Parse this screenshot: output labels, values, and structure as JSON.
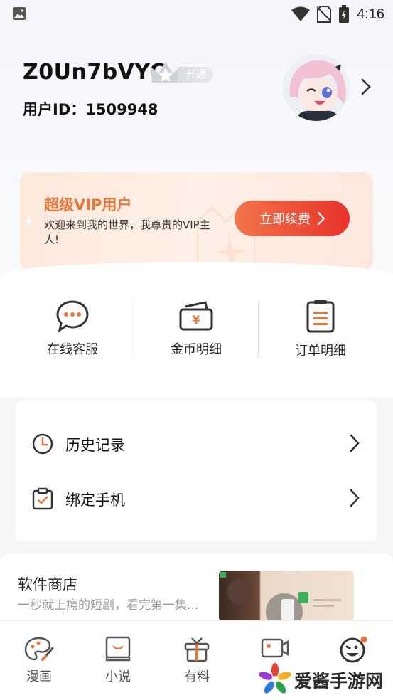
{
  "status_bar": {
    "time": "4:16",
    "icons": [
      "image-notification-icon",
      "wifi-icon",
      "no-sim-icon",
      "battery-charging-icon"
    ]
  },
  "profile": {
    "username": "Z0Un7bVYC",
    "vip_tag": "开通",
    "user_id": "用户ID：1509948"
  },
  "vip_banner": {
    "title": "超级VIP用户",
    "description": "欢迎来到我的世界，我尊贵的VIP主人!",
    "renew_button": "立即续费",
    "colors": {
      "title": "#e9763a",
      "button_start": "#f0754a",
      "button_end": "#e8322b"
    }
  },
  "quick_actions": [
    {
      "label": "在线客服",
      "icon": "chat-bubble-icon"
    },
    {
      "label": "金币明细",
      "icon": "wallet-icon"
    },
    {
      "label": "订单明细",
      "icon": "order-list-icon"
    }
  ],
  "menu": [
    {
      "label": "历史记录",
      "icon": "clock-icon"
    },
    {
      "label": "绑定手机",
      "icon": "clipboard-check-icon"
    }
  ],
  "store": {
    "title": "软件商店",
    "subtitle": "一秒就上瘾的短剧，看完第一集..."
  },
  "tabs": [
    {
      "label": "漫画",
      "icon": "palette-icon"
    },
    {
      "label": "小说",
      "icon": "book-icon"
    },
    {
      "label": "有料",
      "icon": "gift-icon"
    },
    {
      "label": "",
      "icon": "video-icon"
    },
    {
      "label": "",
      "icon": "smile-face-icon"
    }
  ],
  "watermark": {
    "text": "爱酱手游网"
  },
  "accent_color": "#e9763a"
}
